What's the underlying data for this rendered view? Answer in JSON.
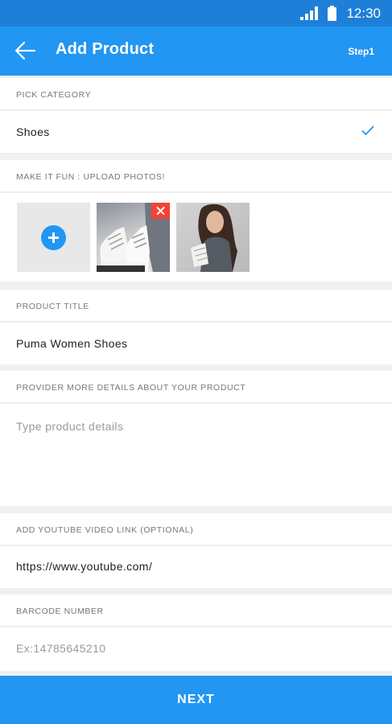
{
  "status_bar": {
    "time": "12:30"
  },
  "app_bar": {
    "title": "Add Product",
    "step": "Step1"
  },
  "sections": {
    "category": {
      "label": "PICK CATEGORY",
      "value": "Shoes"
    },
    "photos": {
      "label": "MAKE IT FUN : UPLOAD PHOTOS!"
    },
    "title": {
      "label": "PRODUCT TITLE",
      "value": "Puma Women Shoes"
    },
    "details": {
      "label": "PROVIDER MORE DETAILS ABOUT YOUR PRODUCT",
      "placeholder": "Type product details"
    },
    "youtube": {
      "label": "ADD YOUTUBE VIDEO LINK (OPTIONAL)",
      "value": "https://www.youtube.com/"
    },
    "barcode": {
      "label": "BARCODE NUMBER",
      "placeholder": "Ex:14785645210"
    }
  },
  "footer": {
    "next_label": "NEXT"
  },
  "colors": {
    "primary": "#2196f3",
    "status_bar": "#1e7fd8",
    "delete": "#f44336"
  }
}
